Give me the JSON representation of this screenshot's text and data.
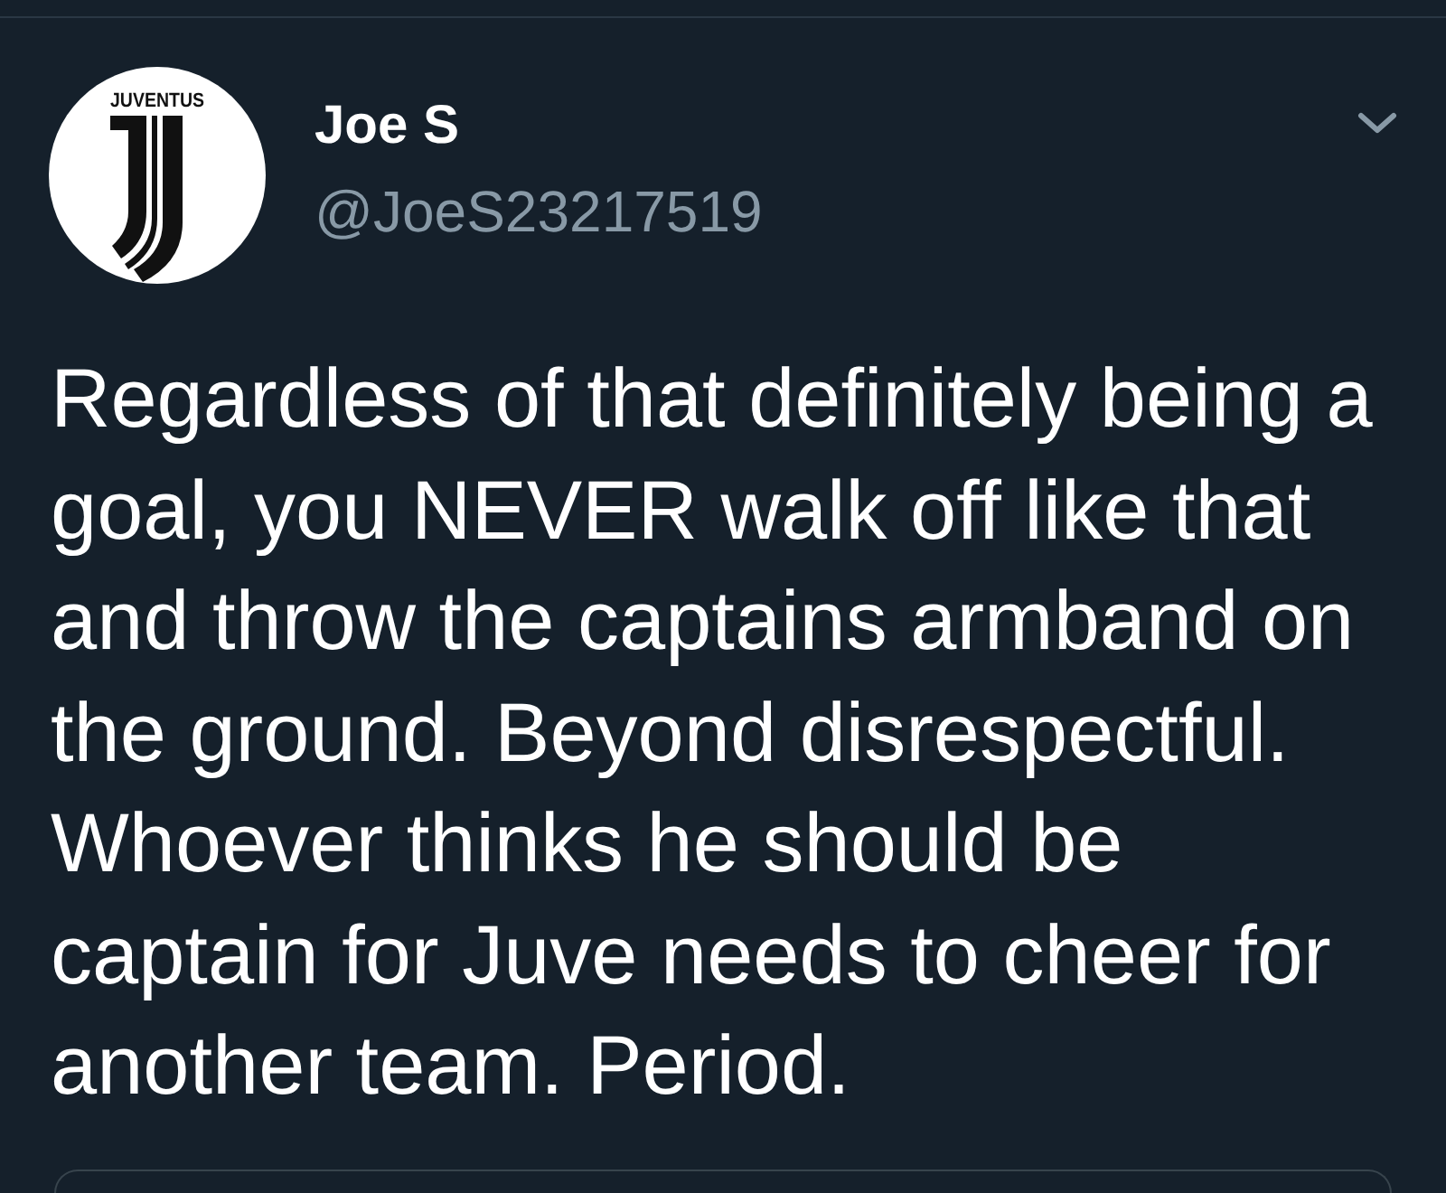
{
  "tweet": {
    "avatar": {
      "logo_text": "JUVENTUS"
    },
    "author": {
      "name": "Joe S",
      "handle": "@JoeS23217519"
    },
    "text": "Regardless of that definitely being a goal, you NEVER walk off like that and throw the captains armband on the ground. Beyond disrespectful. Whoever thinks he should be captain for Juve needs to cheer for another team. Period."
  }
}
